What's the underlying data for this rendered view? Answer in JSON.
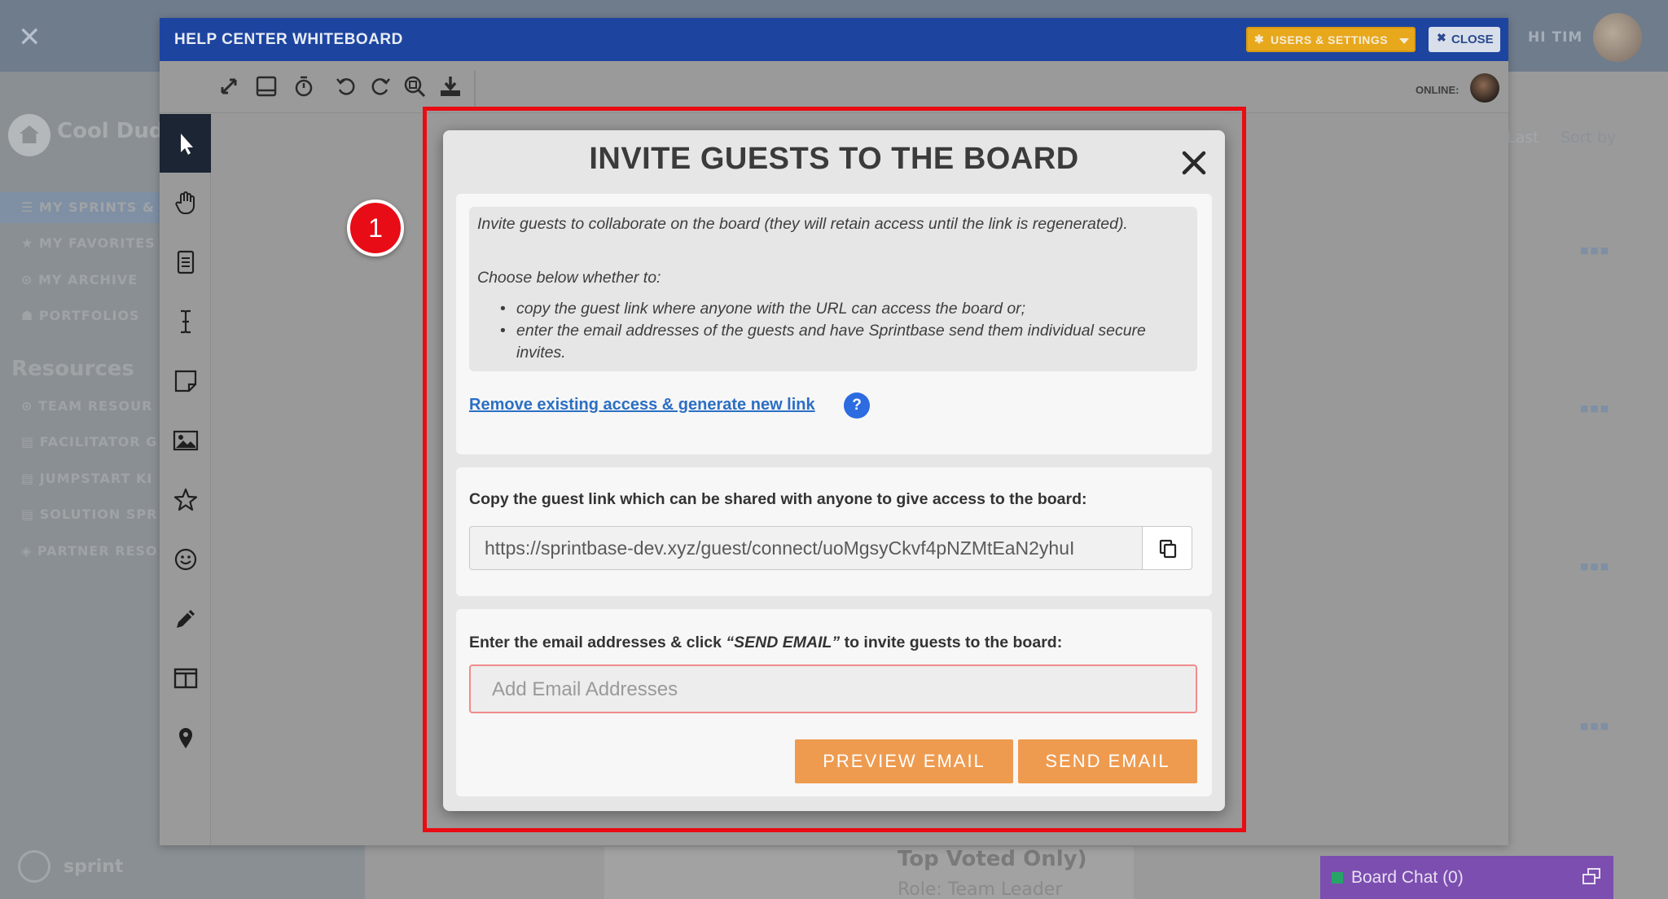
{
  "background": {
    "close_glyph": "✕",
    "greeting": "HI TIM",
    "sidebar_title": "Cool Dud",
    "sidebar_items": [
      "☰  MY SPRINTS &",
      "★  MY FAVORITES",
      "⊙  MY ARCHIVE",
      "☗  PORTFOLIOS"
    ],
    "resources_heading": "Resources",
    "resource_items": [
      "⊙  TEAM RESOUR",
      "▤  FACILITATOR G",
      "▤  JUMPSTART KI",
      "▤  SOLUTION SPR",
      "◈  PARTNER RESO"
    ],
    "logo_text": "sprint",
    "last_label": "Last",
    "sort_label": "Sort by",
    "card_title": "Top Voted Only)",
    "card_role": "Role: Team Leader"
  },
  "whiteboard": {
    "title": "HELP CENTER WHITEBOARD",
    "users_settings_label": "USERS & SETTINGS",
    "close_label": "CLOSE",
    "online_label": "ONLINE:",
    "toolbar_icons": [
      "expand-icon",
      "tablet-icon",
      "timer-icon",
      "undo-icon",
      "redo-icon",
      "zoom-fit-icon",
      "download-icon"
    ],
    "left_tools": [
      "select-pointer-icon",
      "hand-pan-icon",
      "document-icon",
      "text-cursor-icon",
      "sticky-note-icon",
      "image-icon",
      "star-icon",
      "smiley-icon",
      "pencil-icon",
      "columns-icon",
      "location-pin-icon"
    ]
  },
  "annotation": {
    "step_number": "1",
    "frame_color": "#ea0b13"
  },
  "modal": {
    "title": "INVITE GUESTS TO THE BOARD",
    "intro": "Invite guests to collaborate on the board (they will retain access until the link is regenerated).",
    "choose": "Choose below whether to:",
    "bullets": [
      "copy the guest link where anyone with the URL can access the board or;",
      "enter the email addresses of the guests and have Sprintbase send them individual secure invites."
    ],
    "regenerate_link": "Remove existing access & generate new link",
    "help_badge": "?",
    "copy_label": "Copy the guest link which can be shared with anyone to give access to the board:",
    "guest_url": "https://sprintbase-dev.xyz/guest/connect/uoMgsyCkvf4pNZMtEaN2yhuI",
    "email_label_pre": "Enter the email addresses & click ",
    "email_label_em": "“SEND EMAIL”",
    "email_label_post": " to invite guests to the board:",
    "email_placeholder": "Add Email Addresses",
    "preview_button": "PREVIEW EMAIL",
    "send_button": "SEND EMAIL"
  },
  "chat": {
    "label": "Board Chat (0)",
    "status_color": "#27a567"
  },
  "colors": {
    "header_blue": "#1d45a0",
    "accent_orange": "#ee9b50",
    "link_blue": "#2b6fc4",
    "settings_gold": "#e8a81c",
    "chat_purple": "#7b4eb0"
  }
}
